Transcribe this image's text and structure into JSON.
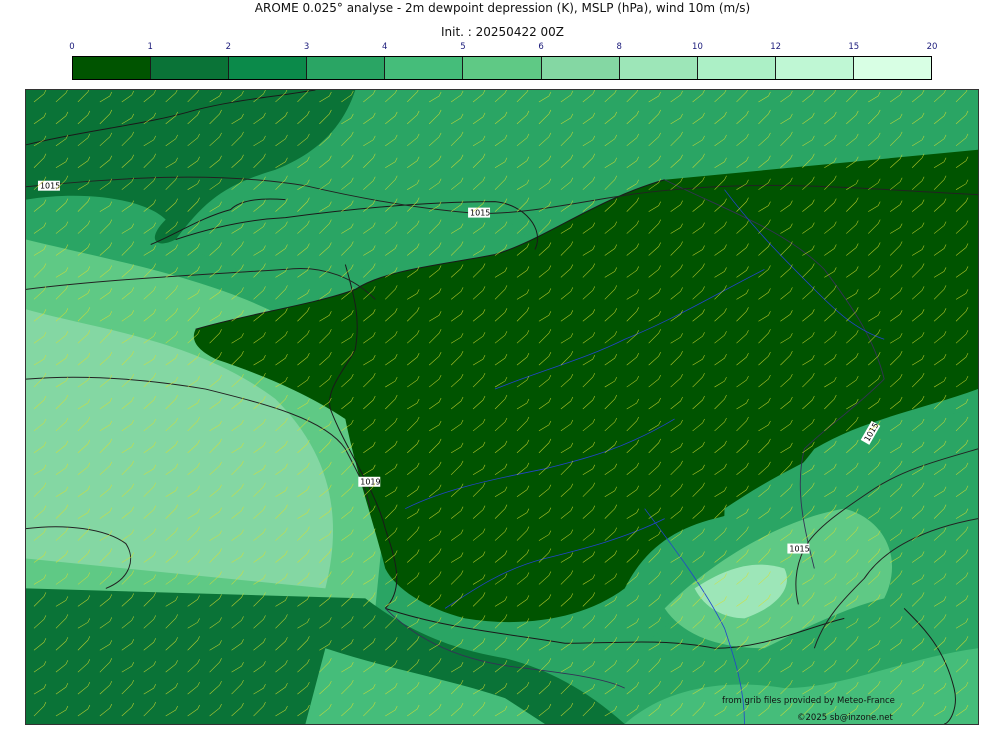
{
  "title": "AROME 0.025° analyse - 2m dewpoint depression (K), MSLP (hPa), wind 10m (m/s)",
  "init": "Init. : 20250422 00Z",
  "colorbar": {
    "ticks": [
      "0",
      "1",
      "2",
      "3",
      "4",
      "5",
      "6",
      "8",
      "10",
      "12",
      "15",
      "20"
    ],
    "colors": [
      "#005400",
      "#0a7337",
      "#0b8a4a",
      "#2aa564",
      "#45bd7a",
      "#5fc985",
      "#84d7a3",
      "#9de6b8",
      "#acf0c6",
      "#bff7d4",
      "#d8ffe4"
    ]
  },
  "map": {
    "isobar_labels": [
      "1015",
      "1015",
      "1015",
      "1015",
      "1019"
    ],
    "wind_barb_color": "#d8e030",
    "coast_color": "#1a1a1a",
    "river_color": "#2244cc"
  },
  "credits": {
    "source": "from grib files provided by Meteo-France",
    "copyright": "©2025 sb@inzone.net"
  }
}
